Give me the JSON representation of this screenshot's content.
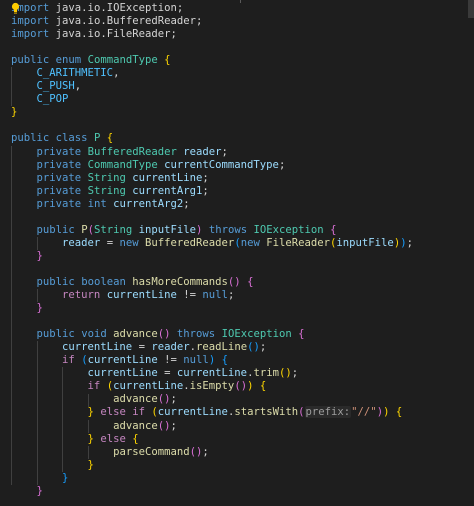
{
  "editor": {
    "language": "java",
    "lines": [
      [
        [
          "kw",
          "import"
        ],
        [
          "",
          "java.io.IOException;"
        ]
      ],
      [
        [
          "kw",
          "import"
        ],
        [
          "",
          "java.io.BufferedReader;"
        ]
      ],
      [
        [
          "kw",
          "import"
        ],
        [
          "",
          "java.io.FileReader;"
        ]
      ],
      [],
      [
        [
          "kw",
          "public"
        ],
        [
          "kw",
          "enum"
        ],
        [
          "ty",
          "CommandType"
        ],
        [
          "p1",
          "{"
        ]
      ],
      [
        [
          "",
          "    "
        ],
        [
          "enm",
          "C_ARITHMETIC"
        ],
        [
          "",
          ","
        ]
      ],
      [
        [
          "",
          "    "
        ],
        [
          "enm",
          "C_PUSH"
        ],
        [
          "",
          ","
        ]
      ],
      [
        [
          "",
          "    "
        ],
        [
          "enm",
          "C_POP"
        ]
      ],
      [
        [
          "p1",
          "}"
        ]
      ],
      [],
      [
        [
          "kw",
          "public"
        ],
        [
          "kw",
          "class"
        ],
        [
          "ty",
          "P"
        ],
        [
          "p1",
          "{"
        ]
      ],
      [
        [
          "",
          "    "
        ],
        [
          "kw",
          "private"
        ],
        [
          "ty",
          "BufferedReader"
        ],
        [
          "var",
          "reader"
        ],
        [
          "",
          ";"
        ]
      ],
      [
        [
          "",
          "    "
        ],
        [
          "kw",
          "private"
        ],
        [
          "ty",
          "CommandType"
        ],
        [
          "var",
          "currentCommandType"
        ],
        [
          "",
          ";"
        ]
      ],
      [
        [
          "",
          "    "
        ],
        [
          "kw",
          "private"
        ],
        [
          "ty",
          "String"
        ],
        [
          "var",
          "currentLine"
        ],
        [
          "",
          ";"
        ]
      ],
      [
        [
          "",
          "    "
        ],
        [
          "kw",
          "private"
        ],
        [
          "ty",
          "String"
        ],
        [
          "var",
          "currentArg1"
        ],
        [
          "",
          ";"
        ]
      ],
      [
        [
          "",
          "    "
        ],
        [
          "kw",
          "private"
        ],
        [
          "kw",
          "int"
        ],
        [
          "var",
          "currentArg2"
        ],
        [
          "",
          ";"
        ]
      ],
      [],
      [
        [
          "",
          "    "
        ],
        [
          "kw",
          "public"
        ],
        [
          "fn",
          "P"
        ],
        [
          "p2",
          "("
        ],
        [
          "ty",
          "String"
        ],
        [
          "var",
          "inputFile"
        ],
        [
          "p2",
          ")"
        ],
        [
          "kw",
          "throws"
        ],
        [
          "ty",
          "IOException"
        ],
        [
          "p2",
          "{"
        ]
      ],
      [
        [
          "",
          "        "
        ],
        [
          "var",
          "reader"
        ],
        [
          "",
          "="
        ],
        [
          "kw",
          "new"
        ],
        [
          "fn",
          "BufferedReader"
        ],
        [
          "p3",
          "("
        ],
        [
          "kw",
          "new"
        ],
        [
          "fn",
          "FileReader"
        ],
        [
          "p1",
          "("
        ],
        [
          "var",
          "inputFile"
        ],
        [
          "p1",
          ")"
        ],
        [
          "p3",
          ")"
        ],
        [
          "",
          ";"
        ]
      ],
      [
        [
          "",
          "    "
        ],
        [
          "p2",
          "}"
        ]
      ],
      [],
      [
        [
          "",
          "    "
        ],
        [
          "kw",
          "public"
        ],
        [
          "kw",
          "boolean"
        ],
        [
          "fn",
          "hasMoreCommands"
        ],
        [
          "p2",
          "()"
        ],
        [
          "p2",
          "{"
        ]
      ],
      [
        [
          "",
          "        "
        ],
        [
          "ctl",
          "return"
        ],
        [
          "var",
          "currentLine"
        ],
        [
          "",
          "!="
        ],
        [
          "kw",
          "null"
        ],
        [
          "",
          ";"
        ]
      ],
      [
        [
          "",
          "    "
        ],
        [
          "p2",
          "}"
        ]
      ],
      [],
      [
        [
          "",
          "    "
        ],
        [
          "kw",
          "public"
        ],
        [
          "kw",
          "void"
        ],
        [
          "fn",
          "advance"
        ],
        [
          "p2",
          "()"
        ],
        [
          "kw",
          "throws"
        ],
        [
          "ty",
          "IOException"
        ],
        [
          "p2",
          "{"
        ]
      ],
      [
        [
          "",
          "        "
        ],
        [
          "var",
          "currentLine"
        ],
        [
          "",
          "="
        ],
        [
          "var",
          "reader"
        ],
        [
          "",
          "."
        ],
        [
          "fn",
          "readLine"
        ],
        [
          "p3",
          "()"
        ],
        [
          "",
          ";"
        ]
      ],
      [
        [
          "",
          "        "
        ],
        [
          "ctl",
          "if"
        ],
        [
          "p3",
          "("
        ],
        [
          "var",
          "currentLine"
        ],
        [
          "",
          "!="
        ],
        [
          "kw",
          "null"
        ],
        [
          "p3",
          ")"
        ],
        [
          "p3",
          "{"
        ]
      ],
      [
        [
          "",
          "            "
        ],
        [
          "var",
          "currentLine"
        ],
        [
          "",
          "="
        ],
        [
          "var",
          "currentLine"
        ],
        [
          "",
          "."
        ],
        [
          "fn",
          "trim"
        ],
        [
          "p1",
          "()"
        ],
        [
          "",
          ";"
        ]
      ],
      [
        [
          "",
          "            "
        ],
        [
          "ctl",
          "if"
        ],
        [
          "p1",
          "("
        ],
        [
          "var",
          "currentLine"
        ],
        [
          "",
          "."
        ],
        [
          "fn",
          "isEmpty"
        ],
        [
          "p2",
          "()"
        ],
        [
          "p1",
          ")"
        ],
        [
          "p1",
          "{"
        ]
      ],
      [
        [
          "",
          "                "
        ],
        [
          "fn",
          "advance"
        ],
        [
          "p2",
          "()"
        ],
        [
          "",
          ";"
        ]
      ],
      [
        [
          "",
          "            "
        ],
        [
          "p1",
          "}"
        ],
        [
          "ctl",
          "else"
        ],
        [
          "ctl",
          "if"
        ],
        [
          "p1",
          "("
        ],
        [
          "var",
          "currentLine"
        ],
        [
          "",
          "."
        ],
        [
          "fn",
          "startsWith"
        ],
        [
          "p2",
          "("
        ],
        [
          "hint",
          "prefix:"
        ],
        [
          "str",
          "\"//\""
        ],
        [
          "p2",
          ")"
        ],
        [
          "p1",
          ")"
        ],
        [
          "p1",
          "{"
        ]
      ],
      [
        [
          "",
          "                "
        ],
        [
          "fn",
          "advance"
        ],
        [
          "p2",
          "()"
        ],
        [
          "",
          ";"
        ]
      ],
      [
        [
          "",
          "            "
        ],
        [
          "p1",
          "}"
        ],
        [
          "ctl",
          "else"
        ],
        [
          "p1",
          "{"
        ]
      ],
      [
        [
          "",
          "                "
        ],
        [
          "fn",
          "parseCommand"
        ],
        [
          "p2",
          "()"
        ],
        [
          "",
          ";"
        ]
      ],
      [
        [
          "",
          "            "
        ],
        [
          "p1",
          "}"
        ]
      ],
      [
        [
          "",
          "        "
        ],
        [
          "p3",
          "}"
        ]
      ],
      [
        [
          "",
          "    "
        ],
        [
          "p2",
          "}"
        ]
      ]
    ]
  }
}
